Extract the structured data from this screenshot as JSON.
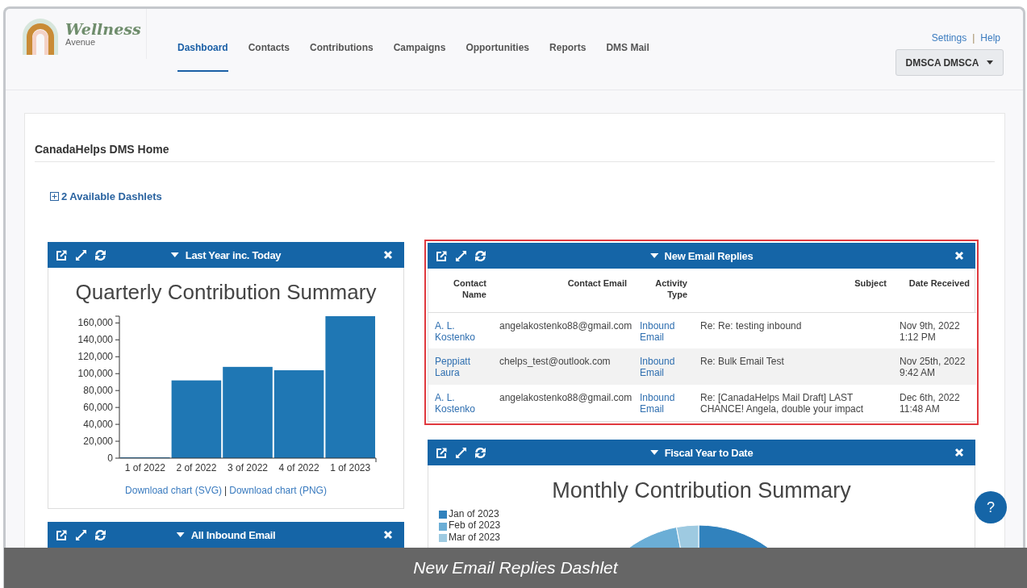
{
  "header": {
    "logo": {
      "script": "Wellness",
      "subtitle": "Avenue"
    },
    "nav": [
      {
        "label": "Dashboard",
        "selected": true
      },
      {
        "label": "Contacts",
        "selected": false
      },
      {
        "label": "Contributions",
        "selected": false
      },
      {
        "label": "Campaigns",
        "selected": false
      },
      {
        "label": "Opportunities",
        "selected": false
      },
      {
        "label": "Reports",
        "selected": false
      },
      {
        "label": "DMS Mail",
        "selected": false
      }
    ],
    "top_links": [
      "Settings",
      "Help"
    ],
    "link_separator": "|",
    "user_menu": "DMSCA DMSCA"
  },
  "page": {
    "title": "CanadaHelps DMS Home",
    "add_dashlets": "2 Available Dashlets"
  },
  "columns": [
    {
      "dashlets": [
        {
          "kind": "bar_chart",
          "title": "Last Year inc. Today",
          "chart_title": "Quarterly Contribution Summary",
          "chart_data": {
            "type": "bar",
            "categories": [
              "1 of 2022",
              "2 of 2022",
              "3 of 2022",
              "4 of 2022",
              "1 of 2023"
            ],
            "series": [
              {
                "color": "#1f77b4",
                "values": [
                  0,
                  92000,
                  108000,
                  104000,
                  168000
                ]
              }
            ],
            "ylim": [
              0,
              168000
            ],
            "yticks": [
              {
                "value": 0,
                "label": "0"
              },
              {
                "value": 20000,
                "label": "20,000"
              },
              {
                "value": 40000,
                "label": "40,000"
              },
              {
                "value": 60000,
                "label": "60,000"
              },
              {
                "value": 80000,
                "label": "80,000"
              },
              {
                "value": 100000,
                "label": "100,000"
              },
              {
                "value": 120000,
                "label": "120,000"
              },
              {
                "value": 140000,
                "label": "140,000"
              },
              {
                "value": 160000,
                "label": "160,000"
              }
            ]
          },
          "downloads": [
            "Download chart (SVG)",
            "Download chart (PNG)"
          ],
          "download_separator": "|"
        },
        {
          "kind": "collapsed",
          "title": "All Inbound Email"
        }
      ]
    },
    {
      "dashlets": [
        {
          "kind": "table",
          "title": "New Email Replies",
          "highlighted": true,
          "columns": [
            "Contact Name",
            "Contact Email",
            "Activity Type",
            "Subject",
            "Date Received"
          ],
          "rows": [
            {
              "contact_name": "A. L. Kostenko",
              "contact_email": "angelakostenko88@gmail.com",
              "activity_type": "Inbound Email",
              "subject": "Re: Re: testing inbound",
              "date_received": "Nov 9th, 2022 1:12 PM"
            },
            {
              "contact_name": "Peppiatt Laura",
              "contact_email": "chelps_test@outlook.com",
              "activity_type": "Inbound Email",
              "subject": "Re: Bulk Email Test",
              "date_received": "Nov 25th, 2022 9:42 AM"
            },
            {
              "contact_name": "A. L. Kostenko",
              "contact_email": "angelakostenko88@gmail.com",
              "activity_type": "Inbound Email",
              "subject": "Re: [CanadaHelps Mail Draft] LAST CHANCE! Angela, double your impact",
              "date_received": "Dec 6th, 2022 11:48 AM"
            }
          ]
        },
        {
          "kind": "pie_chart",
          "title": "Fiscal Year to Date",
          "highlighted": false,
          "chart_title": "Monthly Contribution Summary",
          "legend": [
            {
              "label": "Jan of 2023",
              "color": "#3182bd"
            },
            {
              "label": "Feb of 2023",
              "color": "#6baed6"
            },
            {
              "label": "Mar of 2023",
              "color": "#9ecae1"
            }
          ]
        }
      ]
    }
  ],
  "help_button": "?",
  "caption": "New Email Replies Dashlet"
}
